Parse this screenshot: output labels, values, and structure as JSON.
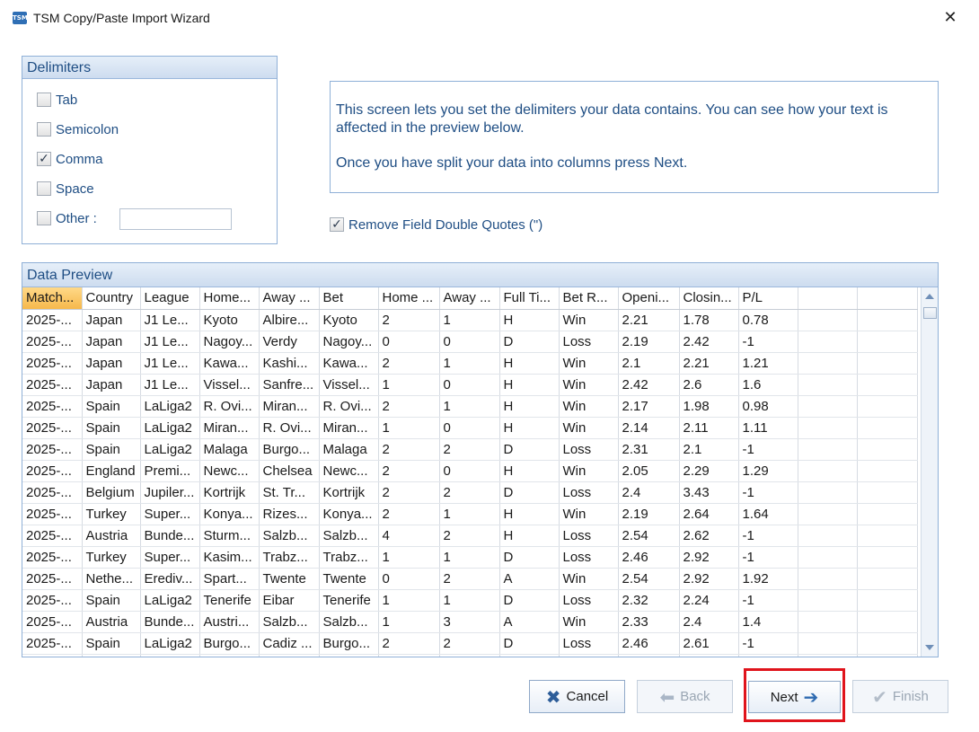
{
  "window": {
    "title": "TSM Copy/Paste Import Wizard",
    "icon_text": "TSM",
    "close_glyph": "✕"
  },
  "delimiters": {
    "header": "Delimiters",
    "options": [
      {
        "label": "Tab",
        "checked": false
      },
      {
        "label": "Semicolon",
        "checked": false
      },
      {
        "label": "Comma",
        "checked": true
      },
      {
        "label": "Space",
        "checked": false
      },
      {
        "label": "Other :",
        "checked": false
      }
    ],
    "other_value": ""
  },
  "info": {
    "line1": "This screen lets you set the delimiters your data contains. You can see how your text is affected in the preview below.",
    "line2": "Once you have split your data into columns press Next."
  },
  "remove_quotes": {
    "label": "Remove Field Double Quotes (\")",
    "checked": true
  },
  "preview": {
    "header": "Data Preview",
    "columns": [
      "Match...",
      "Country",
      "League",
      "Home...",
      "Away ...",
      "Bet",
      "Home ...",
      "Away ...",
      "Full Ti...",
      "Bet R...",
      "Openi...",
      "Closin...",
      "P/L",
      "",
      ""
    ],
    "rows": [
      [
        "2025-...",
        "Japan",
        "J1 Le...",
        "Kyoto",
        "Albire...",
        "Kyoto",
        "2",
        "1",
        "H",
        "Win",
        "2.21",
        "1.78",
        "0.78",
        "",
        ""
      ],
      [
        "2025-...",
        "Japan",
        "J1 Le...",
        "Nagoy...",
        "Verdy",
        "Nagoy...",
        "0",
        "0",
        "D",
        "Loss",
        "2.19",
        "2.42",
        "-1",
        "",
        ""
      ],
      [
        "2025-...",
        "Japan",
        "J1 Le...",
        "Kawa...",
        "Kashi...",
        "Kawa...",
        "2",
        "1",
        "H",
        "Win",
        "2.1",
        "2.21",
        "1.21",
        "",
        ""
      ],
      [
        "2025-...",
        "Japan",
        "J1 Le...",
        "Vissel...",
        "Sanfre...",
        "Vissel...",
        "1",
        "0",
        "H",
        "Win",
        "2.42",
        "2.6",
        "1.6",
        "",
        ""
      ],
      [
        "2025-...",
        "Spain",
        "LaLiga2",
        "R. Ovi...",
        "Miran...",
        "R. Ovi...",
        "2",
        "1",
        "H",
        "Win",
        "2.17",
        "1.98",
        "0.98",
        "",
        ""
      ],
      [
        "2025-...",
        "Spain",
        "LaLiga2",
        "Miran...",
        "R. Ovi...",
        "Miran...",
        "1",
        "0",
        "H",
        "Win",
        "2.14",
        "2.11",
        "1.11",
        "",
        ""
      ],
      [
        "2025-...",
        "Spain",
        "LaLiga2",
        "Malaga",
        "Burgo...",
        "Malaga",
        "2",
        "2",
        "D",
        "Loss",
        "2.31",
        "2.1",
        "-1",
        "",
        ""
      ],
      [
        "2025-...",
        "England",
        "Premi...",
        "Newc...",
        "Chelsea",
        "Newc...",
        "2",
        "0",
        "H",
        "Win",
        "2.05",
        "2.29",
        "1.29",
        "",
        ""
      ],
      [
        "2025-...",
        "Belgium",
        "Jupiler...",
        "Kortrijk",
        "St. Tr...",
        "Kortrijk",
        "2",
        "2",
        "D",
        "Loss",
        "2.4",
        "3.43",
        "-1",
        "",
        ""
      ],
      [
        "2025-...",
        "Turkey",
        "Super...",
        "Konya...",
        "Rizes...",
        "Konya...",
        "2",
        "1",
        "H",
        "Win",
        "2.19",
        "2.64",
        "1.64",
        "",
        ""
      ],
      [
        "2025-...",
        "Austria",
        "Bunde...",
        "Sturm...",
        "Salzb...",
        "Salzb...",
        "4",
        "2",
        "H",
        "Loss",
        "2.54",
        "2.62",
        "-1",
        "",
        ""
      ],
      [
        "2025-...",
        "Turkey",
        "Super...",
        "Kasim...",
        "Trabz...",
        "Trabz...",
        "1",
        "1",
        "D",
        "Loss",
        "2.46",
        "2.92",
        "-1",
        "",
        ""
      ],
      [
        "2025-...",
        "Nethe...",
        "Erediv...",
        "Spart...",
        "Twente",
        "Twente",
        "0",
        "2",
        "A",
        "Win",
        "2.54",
        "2.92",
        "1.92",
        "",
        ""
      ],
      [
        "2025-...",
        "Spain",
        "LaLiga2",
        "Tenerife",
        "Eibar",
        "Tenerife",
        "1",
        "1",
        "D",
        "Loss",
        "2.32",
        "2.24",
        "-1",
        "",
        ""
      ],
      [
        "2025-...",
        "Austria",
        "Bunde...",
        "Austri...",
        "Salzb...",
        "Salzb...",
        "1",
        "3",
        "A",
        "Win",
        "2.33",
        "2.4",
        "1.4",
        "",
        ""
      ],
      [
        "2025-...",
        "Spain",
        "LaLiga2",
        "Burgo...",
        "Cadiz ...",
        "Burgo...",
        "2",
        "2",
        "D",
        "Loss",
        "2.46",
        "2.61",
        "-1",
        "",
        ""
      ],
      [
        "",
        "",
        "",
        "",
        "",
        "",
        "",
        "",
        "",
        "",
        "",
        "",
        "",
        "",
        ""
      ]
    ]
  },
  "buttons": {
    "cancel": {
      "label": "Cancel",
      "icon": "x-icon",
      "glyph": "✖"
    },
    "back": {
      "label": "Back",
      "icon": "arrow-left-icon",
      "glyph": "⬅"
    },
    "next": {
      "label": "Next",
      "icon": "arrow-right-icon",
      "glyph": "➔"
    },
    "finish": {
      "label": "Finish",
      "icon": "checkmark-icon",
      "glyph": "✔"
    }
  },
  "colors": {
    "accent": "#1f4e84",
    "highlight": "#e0141c",
    "active_column": "#f6b84b"
  }
}
